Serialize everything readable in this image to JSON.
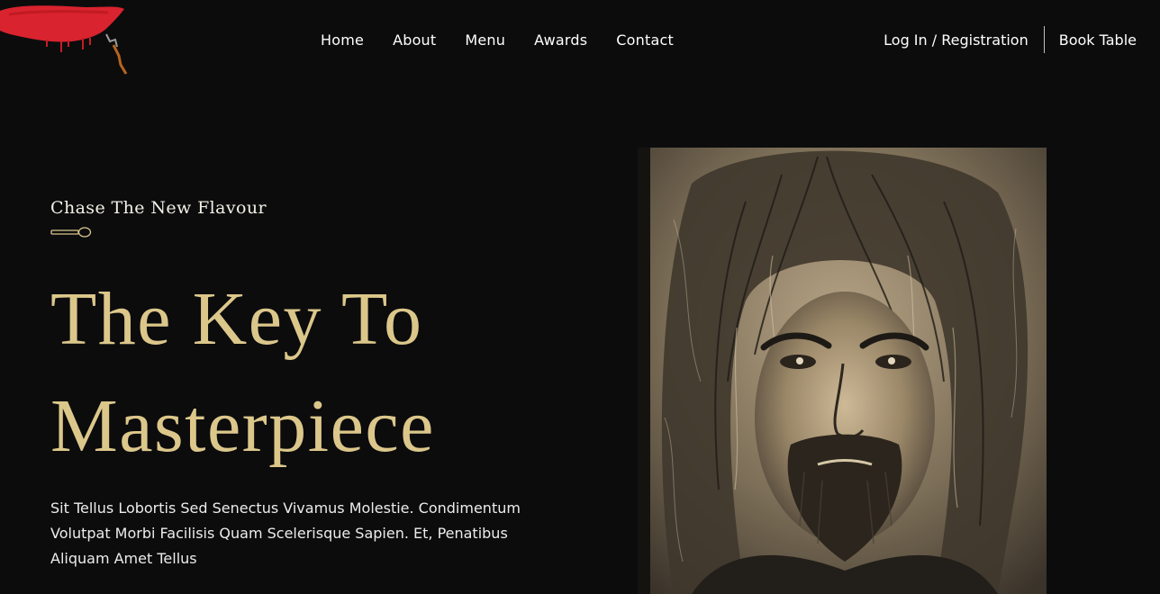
{
  "header": {
    "logo_icon": "red-brush-axe-logo",
    "nav": [
      {
        "label": "Home"
      },
      {
        "label": "About"
      },
      {
        "label": "Menu"
      },
      {
        "label": "Awards"
      },
      {
        "label": "Contact"
      }
    ],
    "login_label": "Log In / Registration",
    "book_label": "Book Table"
  },
  "hero": {
    "tagline": "Chase The New Flavour",
    "tagline_icon": "spoon-icon",
    "headline_line1": "The Key To",
    "headline_line2": "Masterpiece",
    "description": "Sit Tellus Lobortis Sed Senectus Vivamus Molestie. Condimentum Volutpat Morbi Facilisis Quam Scelerisque Sapien. Et, Penatibus Aliquam Amet Tellus",
    "image_icon": "sepia-sketch-portrait-image"
  },
  "colors": {
    "background": "#0c0c0d",
    "accent_gold": "#dcc78b",
    "logo_red": "#d9232e",
    "text": "#ffffff"
  }
}
